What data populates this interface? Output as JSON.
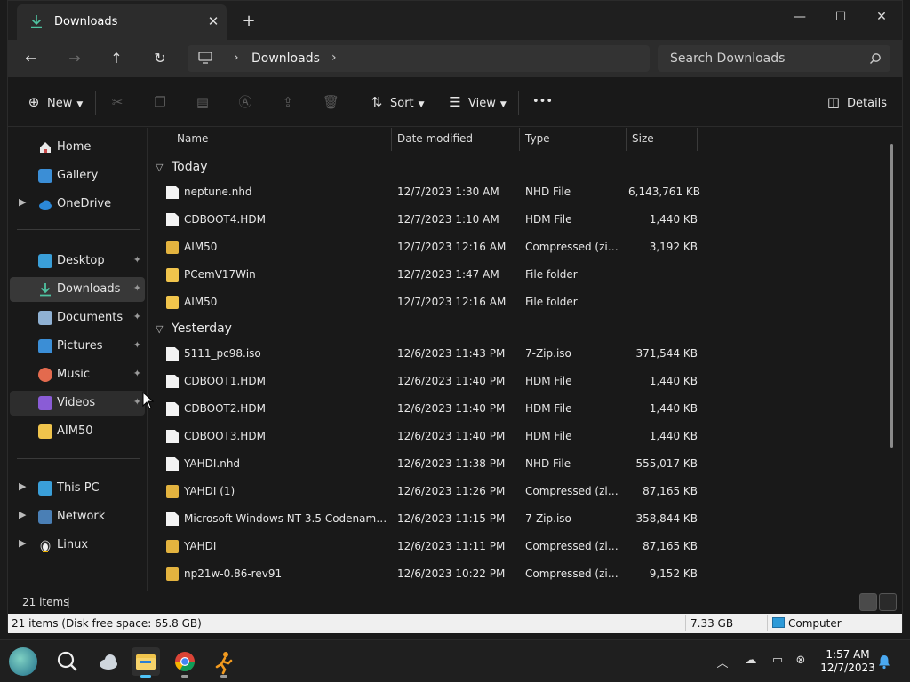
{
  "window": {
    "tab_title": "Downloads",
    "tab_close": "✕",
    "new_tab": "+",
    "minimize": "—",
    "maximize": "☐",
    "close": "✕"
  },
  "address": {
    "back": "←",
    "forward": "→",
    "up": "↑",
    "refresh": "↻",
    "sep": "›",
    "crumb": "Downloads",
    "search_placeholder": "Search Downloads"
  },
  "toolbar": {
    "new_label": "New",
    "sort_label": "Sort",
    "view_label": "View",
    "more_label": "•••",
    "details_label": "Details"
  },
  "navpane": {
    "home": "Home",
    "gallery": "Gallery",
    "onedrive": "OneDrive",
    "desktop": "Desktop",
    "downloads": "Downloads",
    "documents": "Documents",
    "pictures": "Pictures",
    "music": "Music",
    "videos": "Videos",
    "aim50": "AIM50",
    "thispc": "This PC",
    "network": "Network",
    "linux": "Linux",
    "pin": "📌"
  },
  "columns": {
    "name": "Name",
    "date": "Date modified",
    "type": "Type",
    "size": "Size"
  },
  "groups": {
    "today": "Today",
    "yesterday": "Yesterday"
  },
  "files": [
    {
      "name": "neptune.nhd",
      "date": "12/7/2023 1:30 AM",
      "type": "NHD File",
      "size": "6,143,761 KB",
      "kind": "file"
    },
    {
      "name": "CDBOOT4.HDM",
      "date": "12/7/2023 1:10 AM",
      "type": "HDM File",
      "size": "1,440 KB",
      "kind": "file"
    },
    {
      "name": "AIM50",
      "date": "12/7/2023 12:16 AM",
      "type": "Compressed (zipp...",
      "size": "3,192 KB",
      "kind": "zip"
    },
    {
      "name": "PCemV17Win",
      "date": "12/7/2023 1:47 AM",
      "type": "File folder",
      "size": "",
      "kind": "folder"
    },
    {
      "name": "AIM50",
      "date": "12/7/2023 12:16 AM",
      "type": "File folder",
      "size": "",
      "kind": "folder"
    },
    {
      "name": "5111_pc98.iso",
      "date": "12/6/2023 11:43 PM",
      "type": "7-Zip.iso",
      "size": "371,544 KB",
      "kind": "file"
    },
    {
      "name": "CDBOOT1.HDM",
      "date": "12/6/2023 11:40 PM",
      "type": "HDM File",
      "size": "1,440 KB",
      "kind": "file"
    },
    {
      "name": "CDBOOT2.HDM",
      "date": "12/6/2023 11:40 PM",
      "type": "HDM File",
      "size": "1,440 KB",
      "kind": "file"
    },
    {
      "name": "CDBOOT3.HDM",
      "date": "12/6/2023 11:40 PM",
      "type": "HDM File",
      "size": "1,440 KB",
      "kind": "file"
    },
    {
      "name": "YAHDI.nhd",
      "date": "12/6/2023 11:38 PM",
      "type": "NHD File",
      "size": "555,017 KB",
      "kind": "file"
    },
    {
      "name": "YAHDI (1)",
      "date": "12/6/2023 11:26 PM",
      "type": "Compressed (zipp...",
      "size": "87,165 KB",
      "kind": "zip"
    },
    {
      "name": "Microsoft Windows NT 3.5 Codename D...",
      "date": "12/6/2023 11:15 PM",
      "type": "7-Zip.iso",
      "size": "358,844 KB",
      "kind": "file"
    },
    {
      "name": "YAHDI",
      "date": "12/6/2023 11:11 PM",
      "type": "Compressed (zipp...",
      "size": "87,165 KB",
      "kind": "zip"
    },
    {
      "name": "np21w-0.86-rev91",
      "date": "12/6/2023 10:22 PM",
      "type": "Compressed (zipp...",
      "size": "9,152 KB",
      "kind": "zip"
    }
  ],
  "status": {
    "count": "21 items",
    "bar": "|",
    "legacy_left": "21 items (Disk free space: 65.8 GB)",
    "legacy_size": "7.33 GB",
    "legacy_location": "Computer"
  },
  "taskbar": {
    "time": "1:57 AM",
    "date": "12/7/2023"
  },
  "colors": {
    "accent": "#4fc3f7",
    "folder": "#f0c44c",
    "selected_bg": "#383838"
  }
}
